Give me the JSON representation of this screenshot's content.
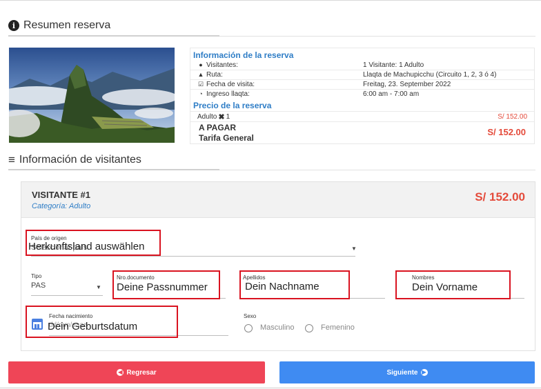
{
  "summary": {
    "title": "Resumen reserva"
  },
  "reservation": {
    "heading": "Información de la reserva",
    "rows": [
      {
        "label": "Visitantes:",
        "value": "1 Visitante: 1 Adulto",
        "icon": "users-icon"
      },
      {
        "label": "Ruta:",
        "value": "Llaqta de Machupicchu (Circuito 1, 2, 3 ó 4)",
        "icon": "route-icon"
      },
      {
        "label": "Fecha de visita:",
        "value": "Freitag, 23. September 2022",
        "icon": "calendar-check-icon"
      },
      {
        "label": "Ingreso llaqta:",
        "value": "6:00 am - 7:00 am",
        "icon": "clock-icon"
      }
    ],
    "price_heading": "Precio de la reserva",
    "line_item": {
      "label": "Adulto",
      "qty": "1",
      "amount": "S/ 152.00"
    },
    "total_label": "A PAGAR",
    "tariff_label": "Tarifa General",
    "total_amount": "S/ 152.00"
  },
  "visitors": {
    "title": "Información de visitantes"
  },
  "visitor": {
    "title": "VISITANTE #1",
    "category": "Categoría: Adulto",
    "price": "S/ 152.00",
    "country": {
      "label": "País de origen",
      "placeholder": "Seleccionar país",
      "annotation": "Herkunftsland auswählen"
    },
    "doc_type": {
      "label": "Tipo",
      "value": "PAS"
    },
    "doc_number": {
      "label": "Nro.documento",
      "annotation": "Deine Passnummer"
    },
    "surnames": {
      "label": "Apellidos",
      "annotation": "Dein Nachname"
    },
    "names": {
      "label": "Nombres",
      "annotation": "Dein Vorname"
    },
    "birthdate": {
      "label": "Fecha nacimiento",
      "placeholder": "dd/mm/aaaa",
      "annotation": "Dein Geburtsdatum"
    },
    "sex": {
      "label": "Sexo",
      "options": [
        "Masculino",
        "Femenino"
      ]
    }
  },
  "buttons": {
    "back": "Regresar",
    "next": "Siguiente"
  },
  "colors": {
    "accent_blue": "#2e7dc6",
    "price_red": "#e44a3a",
    "annotation_red": "#d9121f",
    "back_button": "#ef4557",
    "next_button": "#3f8bf2"
  }
}
